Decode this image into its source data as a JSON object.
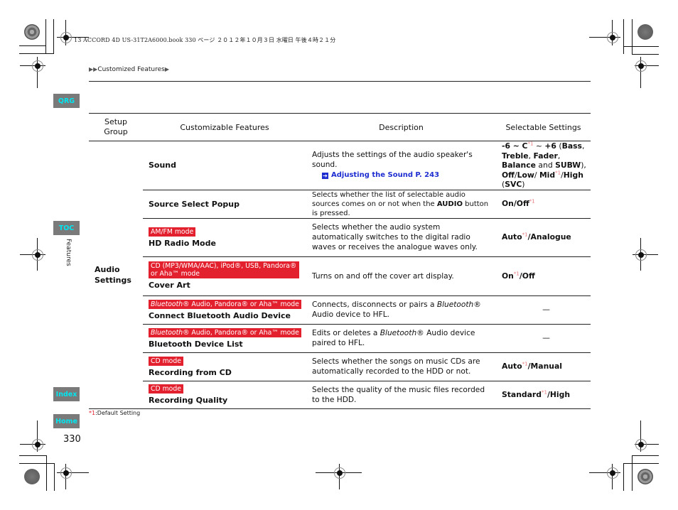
{
  "print_header": "13 ACCORD 4D US-31T2A6000.book   330 ページ   ２０１２年１０月３日   水曜日   午後４時２１分",
  "breadcrumb": {
    "prefix_icon": "double-triangle-right-icon",
    "label": "Customized Features",
    "suffix_icon": "triangle-right-icon"
  },
  "side_nav": {
    "qrg": "QRG",
    "toc": "TOC",
    "index": "Index",
    "home": "Home",
    "section_label": "Features"
  },
  "page_number": "330",
  "table": {
    "headers": [
      "Setup Group",
      "Customizable Features",
      "Description",
      "Selectable Settings"
    ],
    "group": "Audio Settings",
    "rows": [
      {
        "mode": "",
        "feature": "Sound",
        "description": "Adjusts the settings of the audio speaker's sound.",
        "link_label": "Adjusting the Sound",
        "link_page": "P. 243",
        "settings_parts": [
          "-6 ~ C",
          "*1",
          " ~ +6 (Bass, Treble, Fader, Balance and SUBW), Off/Low/Mid",
          "*1",
          "/High (SVC)"
        ]
      },
      {
        "mode": "",
        "feature": "Source Select Popup",
        "description_pre": "Selects whether the list of selectable audio sources comes on or not when the ",
        "description_bold": "AUDIO",
        "description_post": " button is pressed.",
        "settings_a": "On/Off",
        "settings_mark": "*1"
      },
      {
        "mode": "AM/FM mode",
        "feature": "HD Radio Mode",
        "description": "Selects whether the audio system automatically switches to the digital radio waves or receives the analogue waves only.",
        "settings_a": "Auto",
        "settings_mark": "*1",
        "settings_b": "/Analogue"
      },
      {
        "mode": "CD (MP3/WMA/AAC), iPod®, USB, Pandora® or Aha™ mode",
        "feature": "Cover Art",
        "description": "Turns on and off the cover art display.",
        "settings_a": "On",
        "settings_mark": "*1",
        "settings_b": "/Off"
      },
      {
        "mode_italic": "Bluetooth",
        "mode": "® Audio, Pandora® or Aha™ mode",
        "feature": "Connect Bluetooth Audio Device",
        "description_pre": "Connects, disconnects or pairs a ",
        "description_italic": "Bluetooth",
        "description_post": "® Audio device to HFL.",
        "settings": "—"
      },
      {
        "mode_italic": "Bluetooth",
        "mode": "® Audio, Pandora® or Aha™ mode",
        "feature": "Bluetooth Device List",
        "description_pre": "Edits or deletes a ",
        "description_italic": "Bluetooth",
        "description_post": "® Audio device paired to HFL.",
        "settings": "—"
      },
      {
        "mode": "CD mode",
        "feature": "Recording from CD",
        "description": "Selects whether the songs on music CDs are automatically recorded to the HDD or not.",
        "settings_a": "Auto",
        "settings_mark": "*1",
        "settings_b": "/Manual"
      },
      {
        "mode": "CD mode",
        "feature": "Recording Quality",
        "description": "Selects the quality of the music files recorded to the HDD.",
        "settings_a": "Standard",
        "settings_mark": "*1",
        "settings_b": "/High"
      }
    ]
  },
  "footnote": {
    "mark": "*1",
    "text": ":Default Setting"
  },
  "colors": {
    "mode_badge": "#e3202e",
    "link": "#1e2ed0",
    "nav_button_bg": "#7a7a7a",
    "nav_button_text": "#00e6f0"
  }
}
